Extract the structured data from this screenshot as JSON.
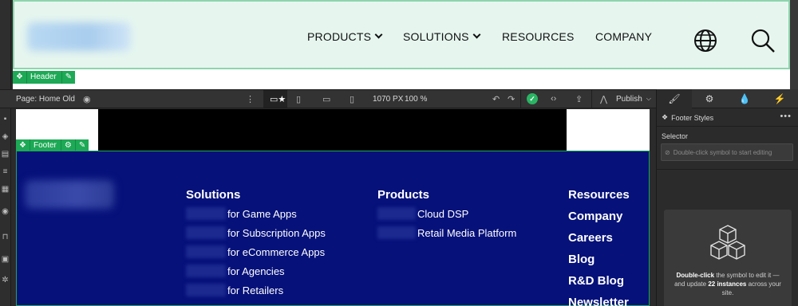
{
  "header": {
    "nav": [
      {
        "label": "PRODUCTS",
        "has_dropdown": true
      },
      {
        "label": "SOLUTIONS",
        "has_dropdown": true
      },
      {
        "label": "RESOURCES",
        "has_dropdown": false
      },
      {
        "label": "COMPANY",
        "has_dropdown": false
      }
    ],
    "symbol_tag": "Header"
  },
  "toolbar": {
    "page_label": "Page: Home Old",
    "canvas_width": "1070 PX",
    "zoom": "100 %",
    "publish_label": "Publish"
  },
  "panel": {
    "title": "Footer Styles",
    "selector_label": "Selector",
    "selector_placeholder": "Double-click symbol to start editing",
    "info_bold1": "Double-click",
    "info_text1": " the symbol to edit it — and update ",
    "info_bold2": "22 instances",
    "info_text2": " across your site."
  },
  "footer": {
    "symbol_tag": "Footer",
    "columns": {
      "solutions": {
        "heading": "Solutions",
        "links": [
          "for Game Apps",
          "for Subscription Apps",
          "for eCommerce Apps",
          "for Agencies",
          "for Retailers"
        ]
      },
      "products": {
        "heading": "Products",
        "links": [
          "Cloud DSP",
          "Retail Media Platform"
        ]
      },
      "misc": [
        "Resources",
        "Company",
        "Careers",
        "Blog",
        "R&D Blog",
        "Newsletter"
      ]
    }
  },
  "colors": {
    "footer_bg": "#06117a",
    "header_bg": "#e6f6ef",
    "symbol_green": "#1da955",
    "editor_dark": "#2b2b2b"
  }
}
